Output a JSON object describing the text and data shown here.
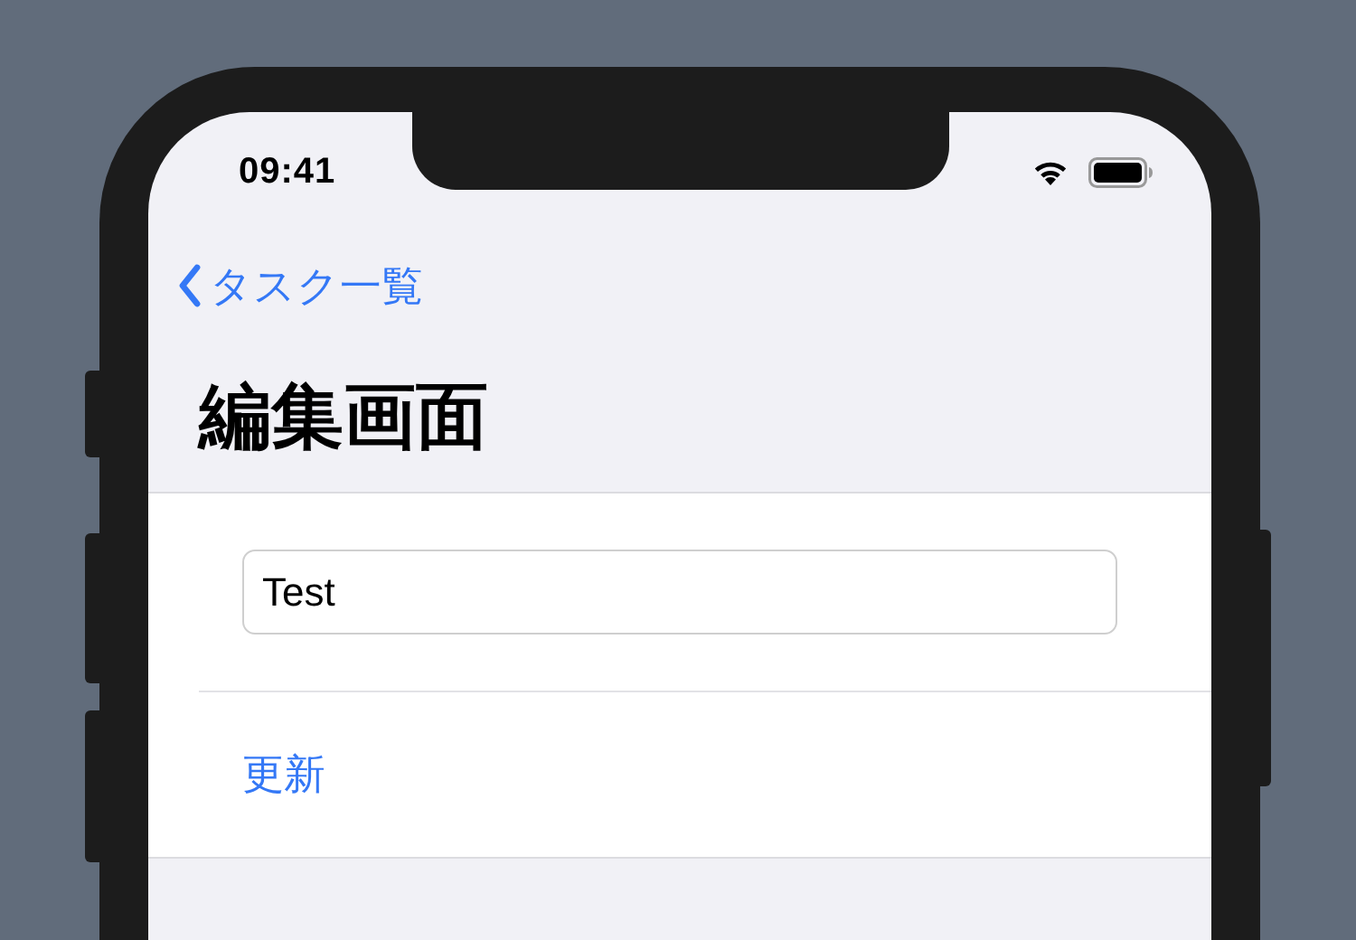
{
  "status_bar": {
    "time": "09:41"
  },
  "navigation_bar": {
    "back_label": "タスク一覧",
    "title": "編集画面"
  },
  "form": {
    "text_field": {
      "value": "Test"
    },
    "button": {
      "label": "更新"
    }
  }
}
